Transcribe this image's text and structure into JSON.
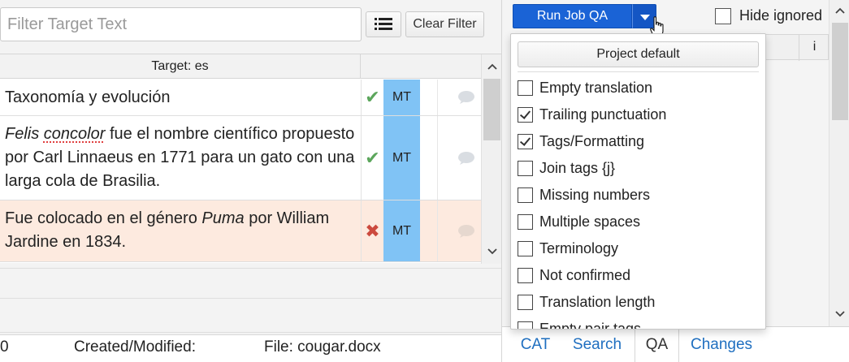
{
  "filter": {
    "placeholder": "Filter Target Text"
  },
  "toolbar": {
    "clear_filter_label": "Clear Filter"
  },
  "grid": {
    "header": "Target: es",
    "rows": [
      {
        "status": "ok",
        "status_glyph": "✔",
        "tag": "MT"
      },
      {
        "status": "ok",
        "status_glyph": "✔",
        "tag": "MT"
      },
      {
        "status": "error",
        "status_glyph": "✖",
        "tag": "MT"
      }
    ],
    "row_texts": {
      "r0": "Taxonomía y evolución",
      "r1_a": "Felis",
      "r1_b": "concolor",
      "r1_c": " fue el nombre científico propuesto por Carl Linnaeus en 1771 para un gato con una larga cola de Brasilia.",
      "r2_a": "Fue colocado en el género ",
      "r2_b": "Puma",
      "r2_c": " por William Jardine en 1834."
    }
  },
  "status_bar": {
    "count": "0",
    "created_modified": "Created/Modified:",
    "file": "File: cougar.docx"
  },
  "qa": {
    "run_label": "Run Job QA",
    "hide_ignored_label": "Hide ignored",
    "hide_ignored_checked": false,
    "column_i": "i",
    "project_default_label": "Project default",
    "checks": [
      {
        "label": "Empty translation",
        "checked": false
      },
      {
        "label": "Trailing punctuation",
        "checked": true
      },
      {
        "label": "Tags/Formatting",
        "checked": true
      },
      {
        "label": "Join tags {j}",
        "checked": false
      },
      {
        "label": "Missing numbers",
        "checked": false
      },
      {
        "label": "Multiple spaces",
        "checked": false
      },
      {
        "label": "Terminology",
        "checked": false
      },
      {
        "label": "Not confirmed",
        "checked": false
      },
      {
        "label": "Translation length",
        "checked": false
      },
      {
        "label": "Empty pair tags",
        "checked": false
      }
    ]
  },
  "tabs": [
    {
      "label": "CAT",
      "active": false
    },
    {
      "label": "Search",
      "active": false
    },
    {
      "label": "QA",
      "active": true
    },
    {
      "label": "Changes",
      "active": false
    }
  ],
  "colors": {
    "accent": "#1a63d6",
    "mt_cell": "#80c3f5",
    "error_row": "#fdeadf",
    "ok": "#5ca65c",
    "error": "#cc4a3e",
    "link": "#1f6fc0"
  }
}
